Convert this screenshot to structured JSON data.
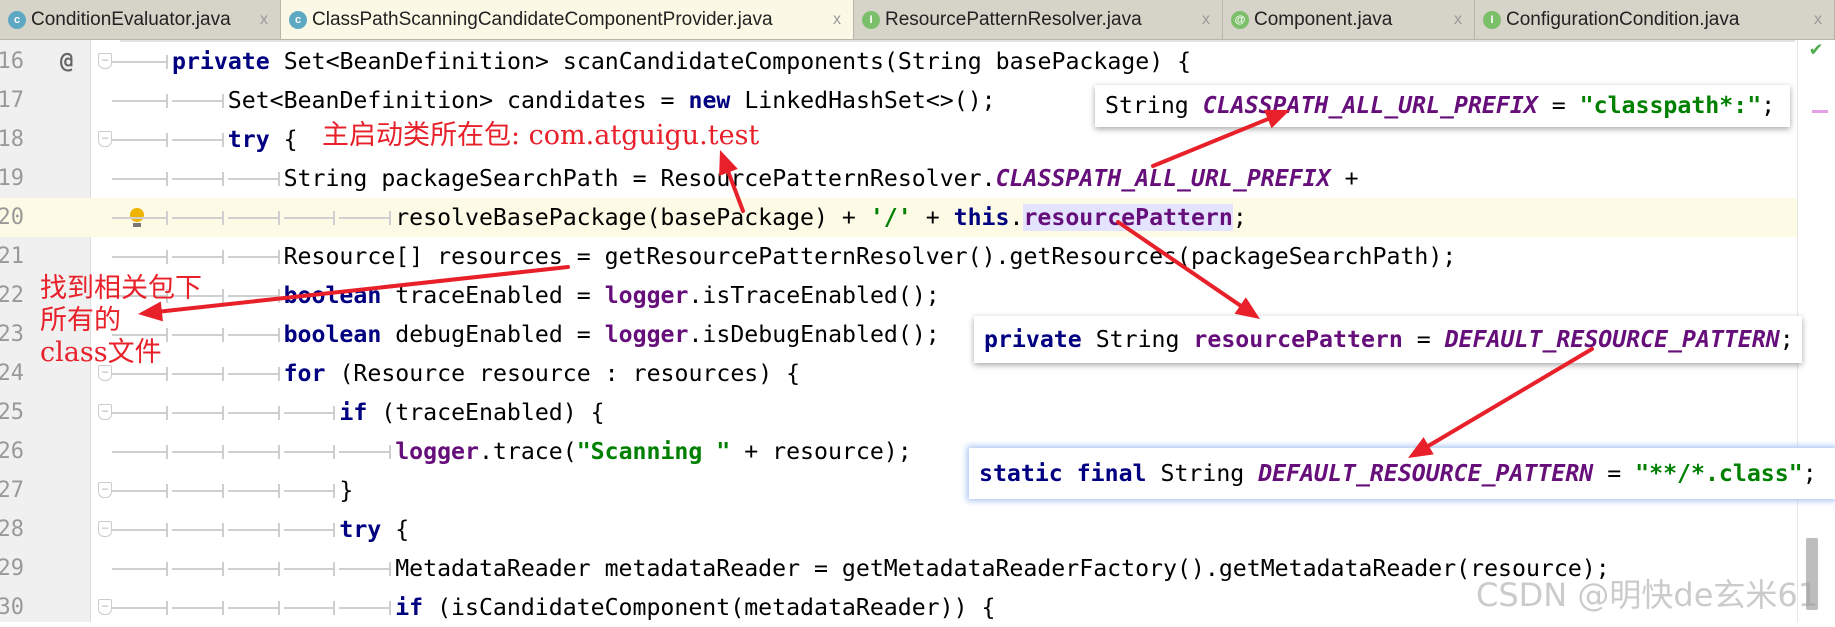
{
  "tabs": [
    {
      "label": "ConditionEvaluator.java",
      "icon": "class-icon",
      "glyph": "c",
      "color": "#5fa8c4",
      "active": false
    },
    {
      "label": "ClassPathScanningCandidateComponentProvider.java",
      "icon": "class-icon",
      "glyph": "c",
      "color": "#5fa8c4",
      "active": true
    },
    {
      "label": "ResourcePatternResolver.java",
      "icon": "interface-icon",
      "glyph": "I",
      "color": "#7cbf6a",
      "active": false
    },
    {
      "label": "Component.java",
      "icon": "annotation-icon",
      "glyph": "@",
      "color": "#7cbf6a",
      "active": false
    },
    {
      "label": "ConfigurationCondition.java",
      "icon": "interface-icon",
      "glyph": "I",
      "color": "#7cbf6a",
      "active": false
    }
  ],
  "close_glyph": "x",
  "editor": {
    "caret_line": "20",
    "lines": [
      {
        "num": "16",
        "indent": 0,
        "fold": true,
        "override": "@",
        "tokens": [
          [
            "private",
            "kw"
          ],
          [
            " Set<BeanDefinition> scanCandidateComponents(String basePackage) {",
            ""
          ]
        ]
      },
      {
        "num": "17",
        "indent": 1,
        "tokens": [
          [
            "Set<BeanDefinition> candidates = ",
            ""
          ],
          [
            "new",
            "kw"
          ],
          [
            " LinkedHashSet<>();",
            ""
          ]
        ]
      },
      {
        "num": "18",
        "indent": 1,
        "fold": true,
        "tokens": [
          [
            "try",
            "kw"
          ],
          [
            " {",
            ""
          ]
        ]
      },
      {
        "num": "19",
        "indent": 2,
        "tokens": [
          [
            "String packageSearchPath = ResourcePatternResolver.",
            ""
          ],
          [
            "CLASSPATH_ALL_URL_PREFIX",
            "field"
          ],
          [
            " +",
            ""
          ]
        ]
      },
      {
        "num": "20",
        "indent": 4,
        "bulb": true,
        "tokens": [
          [
            "resolveBasePackage(basePackage) + ",
            ""
          ],
          [
            "'/'",
            "str"
          ],
          [
            " + ",
            ""
          ],
          [
            "this",
            "kw"
          ],
          [
            ".",
            ""
          ],
          [
            "resourcePattern",
            "member hl"
          ],
          [
            ";",
            ""
          ]
        ]
      },
      {
        "num": "21",
        "indent": 2,
        "tokens": [
          [
            "Resource[] resources = getResourcePatternResolver().getResources(packageSearchPath);",
            ""
          ]
        ]
      },
      {
        "num": "22",
        "indent": 2,
        "tokens": [
          [
            "boolean",
            "kw"
          ],
          [
            " traceEnabled = ",
            ""
          ],
          [
            "logger",
            "member"
          ],
          [
            ".isTraceEnabled();",
            ""
          ]
        ]
      },
      {
        "num": "23",
        "indent": 2,
        "tokens": [
          [
            "boolean",
            "kw"
          ],
          [
            " debugEnabled = ",
            ""
          ],
          [
            "logger",
            "member"
          ],
          [
            ".isDebugEnabled();",
            ""
          ]
        ]
      },
      {
        "num": "24",
        "indent": 2,
        "fold": true,
        "tokens": [
          [
            "for",
            "kw"
          ],
          [
            " (Resource resource : resources) {",
            ""
          ]
        ]
      },
      {
        "num": "25",
        "indent": 3,
        "fold": true,
        "tokens": [
          [
            "if",
            "kw"
          ],
          [
            " (traceEnabled) {",
            ""
          ]
        ]
      },
      {
        "num": "26",
        "indent": 4,
        "tokens": [
          [
            "logger",
            "member"
          ],
          [
            ".trace(",
            ""
          ],
          [
            "\"Scanning \"",
            "str"
          ],
          [
            " + resource);",
            ""
          ]
        ]
      },
      {
        "num": "27",
        "indent": 3,
        "fold": true,
        "tokens": [
          [
            "}",
            ""
          ]
        ]
      },
      {
        "num": "28",
        "indent": 3,
        "fold": true,
        "tokens": [
          [
            "try",
            "kw"
          ],
          [
            " {",
            ""
          ]
        ]
      },
      {
        "num": "29",
        "indent": 4,
        "tokens": [
          [
            "MetadataReader metadataReader = getMetadataReaderFactory().getMetadataReader(resource);",
            ""
          ]
        ]
      },
      {
        "num": "30",
        "indent": 4,
        "fold": true,
        "tokens": [
          [
            "if",
            "kw"
          ],
          [
            " (isCandidateComponent(metadataReader)) {",
            ""
          ]
        ]
      }
    ]
  },
  "popups": [
    {
      "tokens": [
        [
          "String ",
          ""
        ],
        [
          "CLASSPATH_ALL_URL_PREFIX",
          "field"
        ],
        [
          " = ",
          ""
        ],
        [
          "\"classpath*:\"",
          "str"
        ],
        [
          ";",
          ""
        ]
      ]
    },
    {
      "tokens": [
        [
          "private",
          "kw"
        ],
        [
          " String ",
          ""
        ],
        [
          "resourcePattern",
          "member"
        ],
        [
          " = ",
          ""
        ],
        [
          "DEFAULT_RESOURCE_PATTERN",
          "field"
        ],
        [
          ";",
          ""
        ]
      ]
    },
    {
      "tokens": [
        [
          "static final",
          "kw"
        ],
        [
          " String ",
          ""
        ],
        [
          "DEFAULT_RESOURCE_PATTERN",
          "field"
        ],
        [
          " = ",
          ""
        ],
        [
          "\"**/*.class\"",
          "str"
        ],
        [
          ";",
          ""
        ]
      ]
    }
  ],
  "annotations": {
    "package_note": "主启动类所在包: com.atguigu.test",
    "scan_note_lines": [
      "找到相关包下",
      "所有的",
      "class文件"
    ],
    "color": "#e8202a"
  },
  "status": {
    "inspection": "ok-checkmark"
  },
  "watermark": "CSDN @明快de玄米61"
}
